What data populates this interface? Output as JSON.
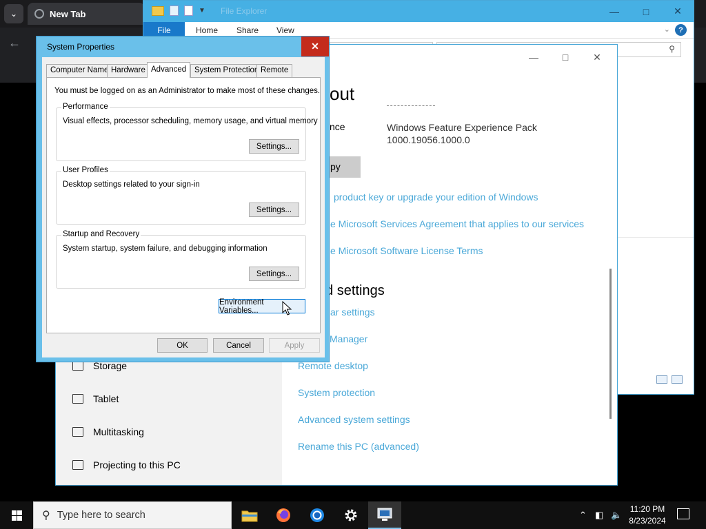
{
  "browser": {
    "tab_title": "New Tab"
  },
  "explorer": {
    "caption": "File Explorer",
    "ribbon_tabs": [
      "File",
      "Home",
      "Share",
      "View"
    ],
    "help_label": "?"
  },
  "settings": {
    "heading": "out",
    "spec_label": "nce",
    "spec_value_line1": "Windows Feature Experience Pack",
    "spec_value_line2": "1000.19056.1000.0",
    "copy_button": "py",
    "links": [
      "product key or upgrade your edition of Windows",
      "e Microsoft Services Agreement that applies to our services",
      "e Microsoft Software License Terms"
    ],
    "related_heading": "ed settings",
    "related_links": [
      "ar settings",
      "Manager",
      "Remote desktop",
      "System protection",
      "Advanced system settings",
      "Rename this PC (advanced)"
    ],
    "nav_items": [
      "Storage",
      "Tablet",
      "Multitasking",
      "Projecting to this PC"
    ]
  },
  "sysprop": {
    "title": "System Properties",
    "close": "✕",
    "tabs": [
      "Computer Name",
      "Hardware",
      "Advanced",
      "System Protection",
      "Remote"
    ],
    "active_tab": "Advanced",
    "admin_note": "You must be logged on as an Administrator to make most of these changes.",
    "groups": [
      {
        "title": "Performance",
        "desc": "Visual effects, processor scheduling, memory usage, and virtual memory",
        "button": "Settings..."
      },
      {
        "title": "User Profiles",
        "desc": "Desktop settings related to your sign-in",
        "button": "Settings..."
      },
      {
        "title": "Startup and Recovery",
        "desc": "System startup, system failure, and debugging information",
        "button": "Settings..."
      }
    ],
    "env_button": "Environment Variables...",
    "ok": "OK",
    "cancel": "Cancel",
    "apply": "Apply"
  },
  "taskbar": {
    "search_placeholder": "Type here to search",
    "time": "11:20 PM",
    "date": "8/23/2024",
    "apps": [
      "file-explorer",
      "firefox",
      "chrome",
      "settings",
      "system-properties"
    ]
  },
  "colors": {
    "accent": "#46b0e4",
    "link": "#4aa8d8",
    "close_red": "#c42b1c",
    "taskbar": "#101010"
  }
}
